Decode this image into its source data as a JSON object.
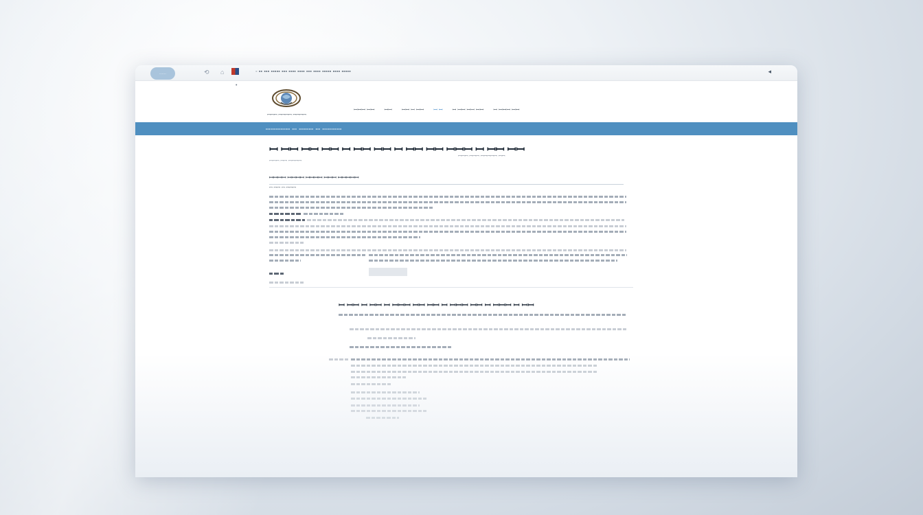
{
  "browser": {
    "tab_label": "......",
    "chrome_icons": [
      "⟲",
      "⌂"
    ],
    "url_text": "◦ ▪▪ ▪▪▪ ▪▪▪▪▪ ▪▪▪ ▪▪▪▪ ▪▪▪▪ ▪▪▪ ▪▪▪▪ ▪▪▪▪▪ ▪▪▪▪ ▪▪▪▪▪",
    "arrow": "◂"
  },
  "site": {
    "logo_text": "ꟷꟷꟷ ꟷꟷꟷꟷ ꟷꟷꟷꟷ",
    "nav": [
      "ꟷꟷꟷ ꟷꟷ",
      "ꟷꟷ",
      "ꟷꟷ ꟷ ꟷꟷ",
      "ꟷ ꟷ",
      "ꟷ ꟷꟷ ꟷꟷ ꟷꟷ",
      "ꟷ ꟷꟷꟷ ꟷꟷ"
    ],
    "bar_text": "ꟷꟷꟷꟷꟷ ꟷ ꟷꟷꟷ ꟷ ꟷꟷꟷꟷ"
  },
  "article": {
    "title": "ꟷ ꟷꟷ ꟷꟷ ꟷꟷ ꟷ ꟷꟷ ꟷꟷ ꟷ ꟷꟷ ꟷꟷ ꟷꟷꟷ ꟷ ꟷꟷ ꟷꟷ",
    "title_sub": "ꟷꟷꟷ ꟷꟷꟷ ꟷꟷꟷꟷꟷ ꟷꟷ",
    "date": "ꟷꟷꟷ ꟷꟷ ꟷꟷꟷꟷ",
    "section_heading": "ꟷꟷꟷꟷ ꟷꟷꟷꟷ ꟷꟷꟷꟷ ꟷꟷꟷ ꟷꟷꟷꟷꟷ",
    "meta": "ꟷ ꟷꟷ ꟷ ꟷꟷꟷ",
    "subtitle": "ꟷ ꟷꟷ ꟷ ꟷꟷ ꟷ ꟷꟷꟷ ꟷꟷ ꟷꟷ ꟷ ꟷꟷꟷ ꟷꟷ ꟷ ꟷꟷꟷ ꟷ ꟷꟷ"
  },
  "colors": {
    "accent_bar": "#4f8fc0",
    "tab_pill": "#a9c4dc",
    "text_dark": "#1f2a36"
  }
}
